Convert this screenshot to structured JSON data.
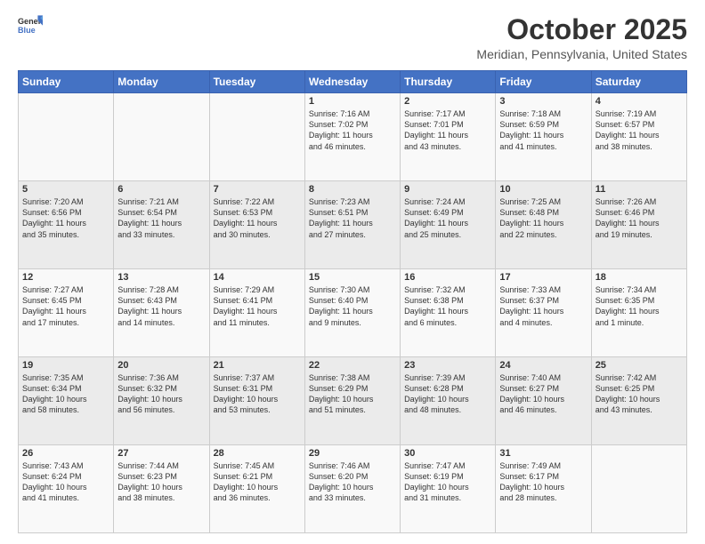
{
  "header": {
    "logo_general": "General",
    "logo_blue": "Blue",
    "title": "October 2025",
    "subtitle": "Meridian, Pennsylvania, United States"
  },
  "calendar": {
    "days_of_week": [
      "Sunday",
      "Monday",
      "Tuesday",
      "Wednesday",
      "Thursday",
      "Friday",
      "Saturday"
    ],
    "weeks": [
      [
        {
          "day": "",
          "info": ""
        },
        {
          "day": "",
          "info": ""
        },
        {
          "day": "",
          "info": ""
        },
        {
          "day": "1",
          "info": "Sunrise: 7:16 AM\nSunset: 7:02 PM\nDaylight: 11 hours\nand 46 minutes."
        },
        {
          "day": "2",
          "info": "Sunrise: 7:17 AM\nSunset: 7:01 PM\nDaylight: 11 hours\nand 43 minutes."
        },
        {
          "day": "3",
          "info": "Sunrise: 7:18 AM\nSunset: 6:59 PM\nDaylight: 11 hours\nand 41 minutes."
        },
        {
          "day": "4",
          "info": "Sunrise: 7:19 AM\nSunset: 6:57 PM\nDaylight: 11 hours\nand 38 minutes."
        }
      ],
      [
        {
          "day": "5",
          "info": "Sunrise: 7:20 AM\nSunset: 6:56 PM\nDaylight: 11 hours\nand 35 minutes."
        },
        {
          "day": "6",
          "info": "Sunrise: 7:21 AM\nSunset: 6:54 PM\nDaylight: 11 hours\nand 33 minutes."
        },
        {
          "day": "7",
          "info": "Sunrise: 7:22 AM\nSunset: 6:53 PM\nDaylight: 11 hours\nand 30 minutes."
        },
        {
          "day": "8",
          "info": "Sunrise: 7:23 AM\nSunset: 6:51 PM\nDaylight: 11 hours\nand 27 minutes."
        },
        {
          "day": "9",
          "info": "Sunrise: 7:24 AM\nSunset: 6:49 PM\nDaylight: 11 hours\nand 25 minutes."
        },
        {
          "day": "10",
          "info": "Sunrise: 7:25 AM\nSunset: 6:48 PM\nDaylight: 11 hours\nand 22 minutes."
        },
        {
          "day": "11",
          "info": "Sunrise: 7:26 AM\nSunset: 6:46 PM\nDaylight: 11 hours\nand 19 minutes."
        }
      ],
      [
        {
          "day": "12",
          "info": "Sunrise: 7:27 AM\nSunset: 6:45 PM\nDaylight: 11 hours\nand 17 minutes."
        },
        {
          "day": "13",
          "info": "Sunrise: 7:28 AM\nSunset: 6:43 PM\nDaylight: 11 hours\nand 14 minutes."
        },
        {
          "day": "14",
          "info": "Sunrise: 7:29 AM\nSunset: 6:41 PM\nDaylight: 11 hours\nand 11 minutes."
        },
        {
          "day": "15",
          "info": "Sunrise: 7:30 AM\nSunset: 6:40 PM\nDaylight: 11 hours\nand 9 minutes."
        },
        {
          "day": "16",
          "info": "Sunrise: 7:32 AM\nSunset: 6:38 PM\nDaylight: 11 hours\nand 6 minutes."
        },
        {
          "day": "17",
          "info": "Sunrise: 7:33 AM\nSunset: 6:37 PM\nDaylight: 11 hours\nand 4 minutes."
        },
        {
          "day": "18",
          "info": "Sunrise: 7:34 AM\nSunset: 6:35 PM\nDaylight: 11 hours\nand 1 minute."
        }
      ],
      [
        {
          "day": "19",
          "info": "Sunrise: 7:35 AM\nSunset: 6:34 PM\nDaylight: 10 hours\nand 58 minutes."
        },
        {
          "day": "20",
          "info": "Sunrise: 7:36 AM\nSunset: 6:32 PM\nDaylight: 10 hours\nand 56 minutes."
        },
        {
          "day": "21",
          "info": "Sunrise: 7:37 AM\nSunset: 6:31 PM\nDaylight: 10 hours\nand 53 minutes."
        },
        {
          "day": "22",
          "info": "Sunrise: 7:38 AM\nSunset: 6:29 PM\nDaylight: 10 hours\nand 51 minutes."
        },
        {
          "day": "23",
          "info": "Sunrise: 7:39 AM\nSunset: 6:28 PM\nDaylight: 10 hours\nand 48 minutes."
        },
        {
          "day": "24",
          "info": "Sunrise: 7:40 AM\nSunset: 6:27 PM\nDaylight: 10 hours\nand 46 minutes."
        },
        {
          "day": "25",
          "info": "Sunrise: 7:42 AM\nSunset: 6:25 PM\nDaylight: 10 hours\nand 43 minutes."
        }
      ],
      [
        {
          "day": "26",
          "info": "Sunrise: 7:43 AM\nSunset: 6:24 PM\nDaylight: 10 hours\nand 41 minutes."
        },
        {
          "day": "27",
          "info": "Sunrise: 7:44 AM\nSunset: 6:23 PM\nDaylight: 10 hours\nand 38 minutes."
        },
        {
          "day": "28",
          "info": "Sunrise: 7:45 AM\nSunset: 6:21 PM\nDaylight: 10 hours\nand 36 minutes."
        },
        {
          "day": "29",
          "info": "Sunrise: 7:46 AM\nSunset: 6:20 PM\nDaylight: 10 hours\nand 33 minutes."
        },
        {
          "day": "30",
          "info": "Sunrise: 7:47 AM\nSunset: 6:19 PM\nDaylight: 10 hours\nand 31 minutes."
        },
        {
          "day": "31",
          "info": "Sunrise: 7:49 AM\nSunset: 6:17 PM\nDaylight: 10 hours\nand 28 minutes."
        },
        {
          "day": "",
          "info": ""
        }
      ]
    ]
  }
}
